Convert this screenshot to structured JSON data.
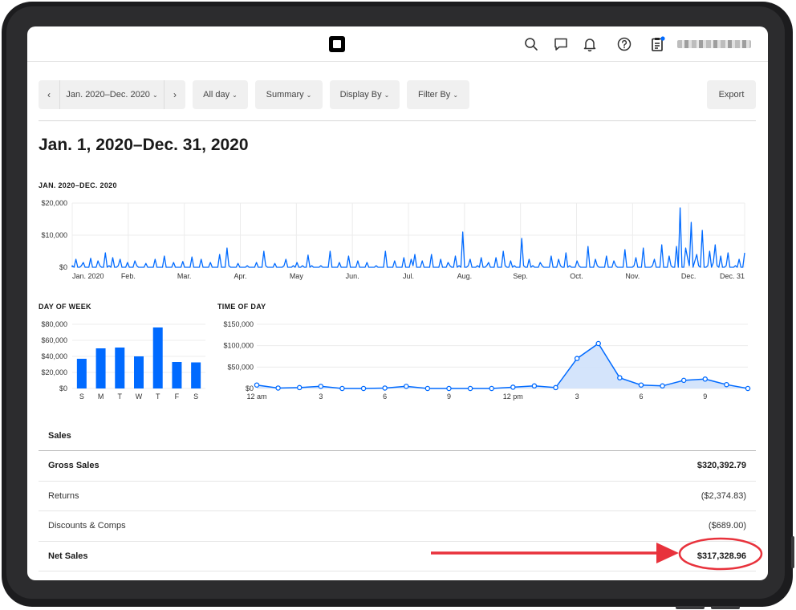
{
  "filters": {
    "prev": "‹",
    "next": "›",
    "date_range": "Jan. 2020–Dec. 2020",
    "time": "All day",
    "summary": "Summary",
    "display_by": "Display By",
    "filter_by": "Filter By",
    "export": "Export",
    "caret": "⌄"
  },
  "page_title": "Jan. 1, 2020–Dec. 31, 2020",
  "icons": [
    "search-icon",
    "chat-icon",
    "bell-icon",
    "help-icon",
    "clipboard-icon"
  ],
  "colors": {
    "accent": "#006aff",
    "area_fill": "#cfe1fb",
    "annotation": "#e8323c",
    "notification": "#006aff"
  },
  "chart_data": [
    {
      "type": "line",
      "title": "JAN. 2020–DEC. 2020",
      "y_ticks": [
        "$20,000",
        "$10,000",
        "$0"
      ],
      "ylim": [
        0,
        20000
      ],
      "x_ticks": [
        "Jan. 2020",
        "Feb.",
        "Mar.",
        "Apr.",
        "May",
        "Jun.",
        "Jul.",
        "Aug.",
        "Sep.",
        "Oct.",
        "Nov.",
        "Dec.",
        "Dec. 31"
      ],
      "spikes": [
        {
          "day": 2,
          "v": 2500
        },
        {
          "day": 6,
          "v": 1500
        },
        {
          "day": 10,
          "v": 2800
        },
        {
          "day": 14,
          "v": 2000
        },
        {
          "day": 18,
          "v": 4500
        },
        {
          "day": 22,
          "v": 3000
        },
        {
          "day": 26,
          "v": 2500
        },
        {
          "day": 30,
          "v": 1500
        },
        {
          "day": 34,
          "v": 2000
        },
        {
          "day": 40,
          "v": 1200
        },
        {
          "day": 45,
          "v": 2500
        },
        {
          "day": 50,
          "v": 3500
        },
        {
          "day": 55,
          "v": 1500
        },
        {
          "day": 60,
          "v": 1800
        },
        {
          "day": 65,
          "v": 3200
        },
        {
          "day": 70,
          "v": 2500
        },
        {
          "day": 75,
          "v": 1500
        },
        {
          "day": 80,
          "v": 4000
        },
        {
          "day": 84,
          "v": 6000
        },
        {
          "day": 90,
          "v": 1200
        },
        {
          "day": 100,
          "v": 1500
        },
        {
          "day": 104,
          "v": 5000
        },
        {
          "day": 110,
          "v": 1200
        },
        {
          "day": 116,
          "v": 2500
        },
        {
          "day": 122,
          "v": 1500
        },
        {
          "day": 128,
          "v": 3800
        },
        {
          "day": 140,
          "v": 5000
        },
        {
          "day": 145,
          "v": 1500
        },
        {
          "day": 150,
          "v": 3500
        },
        {
          "day": 155,
          "v": 2000
        },
        {
          "day": 160,
          "v": 1500
        },
        {
          "day": 170,
          "v": 5000
        },
        {
          "day": 175,
          "v": 2000
        },
        {
          "day": 180,
          "v": 3000
        },
        {
          "day": 184,
          "v": 2500
        },
        {
          "day": 186,
          "v": 4000
        },
        {
          "day": 190,
          "v": 2000
        },
        {
          "day": 195,
          "v": 4000
        },
        {
          "day": 200,
          "v": 2500
        },
        {
          "day": 204,
          "v": 1500
        },
        {
          "day": 208,
          "v": 3500
        },
        {
          "day": 212,
          "v": 11000
        },
        {
          "day": 216,
          "v": 2500
        },
        {
          "day": 222,
          "v": 3000
        },
        {
          "day": 226,
          "v": 1500
        },
        {
          "day": 230,
          "v": 3000
        },
        {
          "day": 234,
          "v": 5000
        },
        {
          "day": 238,
          "v": 2000
        },
        {
          "day": 244,
          "v": 9000
        },
        {
          "day": 248,
          "v": 2500
        },
        {
          "day": 254,
          "v": 1500
        },
        {
          "day": 260,
          "v": 3500
        },
        {
          "day": 264,
          "v": 2500
        },
        {
          "day": 268,
          "v": 4500
        },
        {
          "day": 274,
          "v": 2000
        },
        {
          "day": 280,
          "v": 6500
        },
        {
          "day": 284,
          "v": 2500
        },
        {
          "day": 290,
          "v": 3500
        },
        {
          "day": 294,
          "v": 2000
        },
        {
          "day": 300,
          "v": 5500
        },
        {
          "day": 306,
          "v": 3000
        },
        {
          "day": 310,
          "v": 6000
        },
        {
          "day": 316,
          "v": 2500
        },
        {
          "day": 320,
          "v": 7000
        },
        {
          "day": 324,
          "v": 3500
        },
        {
          "day": 328,
          "v": 6500
        },
        {
          "day": 334,
          "v": 3000
        },
        {
          "day": 338,
          "v": 2000
        },
        {
          "day": 342,
          "v": 3500
        },
        {
          "day": 348,
          "v": 1500
        },
        {
          "day": 352,
          "v": 2500
        }
      ],
      "big_spikes": [
        {
          "day": 330,
          "v": 18500
        },
        {
          "day": 333,
          "v": 6000
        },
        {
          "day": 336,
          "v": 14000
        },
        {
          "day": 339,
          "v": 4000
        },
        {
          "day": 342,
          "v": 11500
        },
        {
          "day": 346,
          "v": 5000
        },
        {
          "day": 349,
          "v": 7000
        },
        {
          "day": 352,
          "v": 3500
        },
        {
          "day": 356,
          "v": 4500
        },
        {
          "day": 362,
          "v": 2500
        },
        {
          "day": 365,
          "v": 4500
        }
      ]
    },
    {
      "type": "bar",
      "title": "DAY OF WEEK",
      "categories": [
        "S",
        "M",
        "T",
        "W",
        "T",
        "F",
        "S"
      ],
      "values": [
        37000,
        50000,
        51000,
        40000,
        76000,
        33000,
        32500
      ],
      "y_ticks": [
        "$80,000",
        "$60,000",
        "$40,000",
        "$20,000",
        "$0"
      ],
      "ylim": [
        0,
        80000
      ]
    },
    {
      "type": "area",
      "title": "TIME OF DAY",
      "x_ticks": [
        "12 am",
        "3",
        "6",
        "9",
        "12 pm",
        "3",
        "6",
        "9"
      ],
      "values": [
        8000,
        1000,
        2000,
        5000,
        0,
        0,
        1000,
        5000,
        0,
        0,
        0,
        0,
        3000,
        6000,
        2000,
        70000,
        105000,
        25000,
        8000,
        6000,
        19000,
        22000,
        9000,
        0
      ],
      "y_ticks": [
        "$150,000",
        "$100,000",
        "$50,000",
        "$0"
      ],
      "ylim": [
        0,
        150000
      ]
    }
  ],
  "sales": {
    "header": "Sales",
    "rows": [
      {
        "label": "Gross Sales",
        "value": "$320,392.79",
        "bold": true
      },
      {
        "label": "Returns",
        "value": "($2,374.83)",
        "bold": false
      },
      {
        "label": "Discounts & Comps",
        "value": "($689.00)",
        "bold": false
      },
      {
        "label": "Net Sales",
        "value": "$317,328.96",
        "bold": true
      }
    ]
  }
}
